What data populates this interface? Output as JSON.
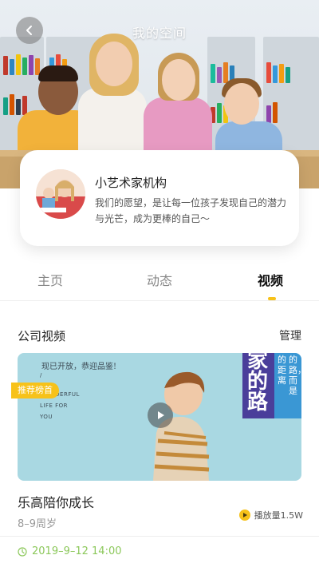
{
  "header": {
    "title": "我的空间",
    "back_icon": "chevron-left-icon"
  },
  "org": {
    "name": "小艺术家机构",
    "description": "我们的愿望，是让每一位孩子发现自己的潜力与光芒，成为更棒的自己～"
  },
  "tabs": [
    {
      "label": "主页",
      "active": false
    },
    {
      "label": "动态",
      "active": false
    },
    {
      "label": "视频",
      "active": true
    }
  ],
  "section": {
    "title": "公司视频",
    "manage_label": "管理"
  },
  "video": {
    "badge": "推荐榜首",
    "thumbnail_caption": "现已开放，恭迎品鉴!",
    "thumbnail_small_lines": [
      "/",
      "WONDERFUL",
      "LIFE FOR",
      "YOU"
    ],
    "thumbnail_panel_text": [
      "家",
      "的",
      "路"
    ],
    "thumbnail_side_text": [
      "的距离",
      "的路，而是"
    ],
    "title": "乐高陪你成长",
    "age": "8–9周岁",
    "play_count": "播放量1.5W",
    "date": "2019–9–12 14:00"
  },
  "colors": {
    "accent": "#f7c21a",
    "date_green": "#8cc85b"
  }
}
